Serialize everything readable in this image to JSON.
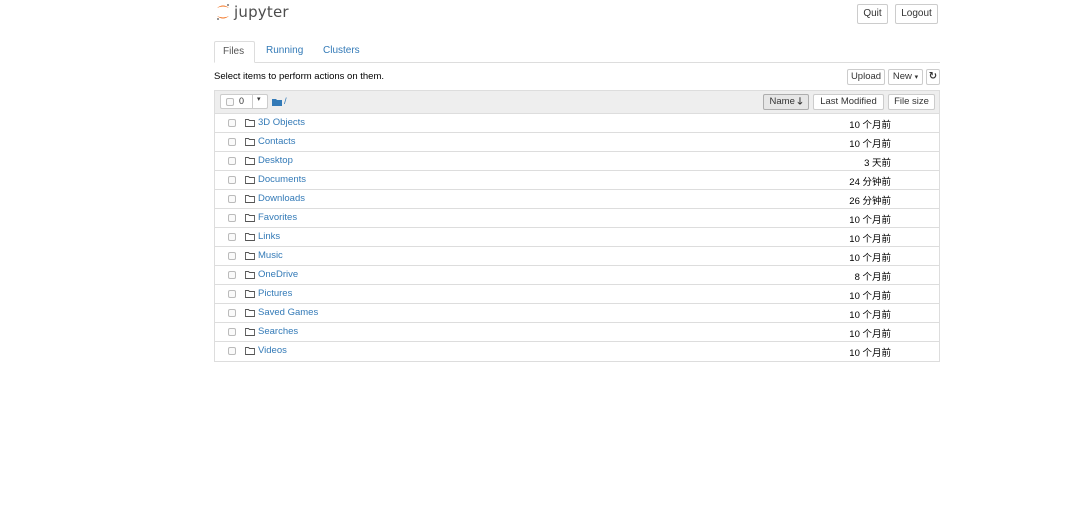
{
  "header": {
    "logo_text": "jupyter",
    "quit_label": "Quit",
    "logout_label": "Logout"
  },
  "tabs": [
    {
      "label": "Files",
      "active": true
    },
    {
      "label": "Running",
      "active": false
    },
    {
      "label": "Clusters",
      "active": false
    }
  ],
  "toolbar": {
    "instructions": "Select items to perform actions on them.",
    "upload_label": "Upload",
    "new_label": "New",
    "refresh_icon": "refresh-icon"
  },
  "list_header": {
    "selected_count": "0",
    "breadcrumb": "/",
    "name_label": "Name",
    "last_modified_label": "Last Modified",
    "file_size_label": "File size"
  },
  "items": [
    {
      "name": "3D Objects",
      "modified": "10 个月前"
    },
    {
      "name": "Contacts",
      "modified": "10 个月前"
    },
    {
      "name": "Desktop",
      "modified": "3 天前"
    },
    {
      "name": "Documents",
      "modified": "24 分钟前"
    },
    {
      "name": "Downloads",
      "modified": "26 分钟前"
    },
    {
      "name": "Favorites",
      "modified": "10 个月前"
    },
    {
      "name": "Links",
      "modified": "10 个月前"
    },
    {
      "name": "Music",
      "modified": "10 个月前"
    },
    {
      "name": "OneDrive",
      "modified": "8 个月前"
    },
    {
      "name": "Pictures",
      "modified": "10 个月前"
    },
    {
      "name": "Saved Games",
      "modified": "10 个月前"
    },
    {
      "name": "Searches",
      "modified": "10 个月前"
    },
    {
      "name": "Videos",
      "modified": "10 个月前"
    }
  ],
  "colors": {
    "link": "#337ab7",
    "logo_orange": "#f37726",
    "border": "#dddddd"
  }
}
